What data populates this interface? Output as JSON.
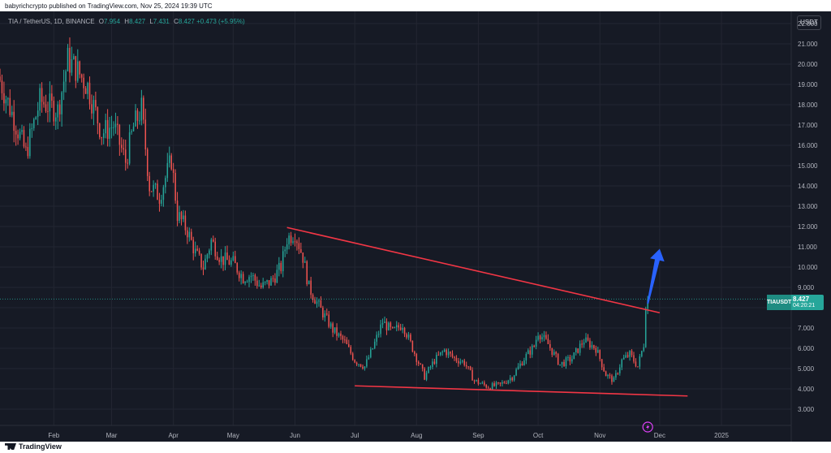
{
  "publisher_line": "babyrichcrypto published on TradingView.com, Nov 25, 2024 19:39 UTC",
  "legend": {
    "symbol": "TIA / TetherUS, 1D, BINANCE",
    "open_k": "O",
    "open": "7.954",
    "high_k": "H",
    "high": "8.427",
    "low_k": "L",
    "low": "7.431",
    "close_k": "C",
    "close": "8.427",
    "change": "+0.473 (+5.95%)"
  },
  "currency_button": "USDT",
  "price_tag": {
    "symbol": "TIAUSDT",
    "price": "8.427",
    "countdown": "04:20:21"
  },
  "footer": {
    "brand": "TradingView"
  },
  "colors": {
    "up": "#26a69a",
    "down": "#ef5350",
    "background": "#161a25",
    "trendline": "#f23645",
    "arrow": "#2962ff"
  },
  "chart_data": {
    "type": "candlestick",
    "title": "",
    "ylim": [
      2.2,
      22.6
    ],
    "y_ticks": [
      "3.000",
      "4.000",
      "5.000",
      "6.000",
      "7.000",
      "8.000",
      "9.000",
      "10.000",
      "11.000",
      "12.000",
      "13.000",
      "14.000",
      "15.000",
      "16.000",
      "17.000",
      "18.000",
      "19.000",
      "20.000",
      "21.000",
      "22.000"
    ],
    "x_ticks": [
      "Feb",
      "Mar",
      "Apr",
      "May",
      "Jun",
      "Jul",
      "Aug",
      "Sep",
      "Oct",
      "Nov",
      "Dec",
      "2025"
    ],
    "x_tick_dates": [
      "2024-02-01",
      "2024-03-01",
      "2024-04-01",
      "2024-05-01",
      "2024-06-01",
      "2024-07-01",
      "2024-08-01",
      "2024-09-01",
      "2024-10-01",
      "2024-11-01",
      "2024-12-01",
      "2025-01-01"
    ],
    "x_range": [
      "2024-01-05",
      "2025-02-05"
    ],
    "last_price": 8.427,
    "close_path": [
      [
        "2024-01-05",
        19.2
      ],
      [
        "2024-01-12",
        17.3
      ],
      [
        "2024-01-18",
        15.6
      ],
      [
        "2024-01-25",
        18.2
      ],
      [
        "2024-02-03",
        17.7
      ],
      [
        "2024-02-08",
        20.2
      ],
      [
        "2024-02-12",
        19.8
      ],
      [
        "2024-02-18",
        18.9
      ],
      [
        "2024-02-25",
        16.6
      ],
      [
        "2024-03-02",
        17.0
      ],
      [
        "2024-03-08",
        15.2
      ],
      [
        "2024-03-12",
        16.9
      ],
      [
        "2024-03-16",
        17.8
      ],
      [
        "2024-03-20",
        14.0
      ],
      [
        "2024-03-25",
        13.5
      ],
      [
        "2024-03-31",
        15.3
      ],
      [
        "2024-04-03",
        12.6
      ],
      [
        "2024-04-08",
        11.8
      ],
      [
        "2024-04-12",
        10.7
      ],
      [
        "2024-04-16",
        10.0
      ],
      [
        "2024-04-20",
        11.3
      ],
      [
        "2024-04-25",
        10.4
      ],
      [
        "2024-05-01",
        10.2
      ],
      [
        "2024-05-06",
        9.5
      ],
      [
        "2024-05-10",
        9.6
      ],
      [
        "2024-05-15",
        9.0
      ],
      [
        "2024-05-20",
        9.3
      ],
      [
        "2024-05-25",
        10.0
      ],
      [
        "2024-05-28",
        11.4
      ],
      [
        "2024-06-01",
        11.7
      ],
      [
        "2024-06-05",
        10.5
      ],
      [
        "2024-06-08",
        9.0
      ],
      [
        "2024-06-14",
        7.9
      ],
      [
        "2024-06-20",
        6.9
      ],
      [
        "2024-06-26",
        6.3
      ],
      [
        "2024-07-01",
        5.4
      ],
      [
        "2024-07-06",
        5.1
      ],
      [
        "2024-07-10",
        6.0
      ],
      [
        "2024-07-15",
        7.3
      ],
      [
        "2024-07-20",
        6.8
      ],
      [
        "2024-07-25",
        7.2
      ],
      [
        "2024-07-30",
        6.0
      ],
      [
        "2024-08-05",
        4.6
      ],
      [
        "2024-08-10",
        5.4
      ],
      [
        "2024-08-15",
        5.9
      ],
      [
        "2024-08-20",
        5.5
      ],
      [
        "2024-08-25",
        5.3
      ],
      [
        "2024-08-30",
        4.4
      ],
      [
        "2024-09-06",
        4.1
      ],
      [
        "2024-09-12",
        4.2
      ],
      [
        "2024-09-18",
        4.6
      ],
      [
        "2024-09-24",
        5.5
      ],
      [
        "2024-09-29",
        6.1
      ],
      [
        "2024-10-01",
        6.8
      ],
      [
        "2024-10-06",
        6.2
      ],
      [
        "2024-10-12",
        5.2
      ],
      [
        "2024-10-18",
        5.5
      ],
      [
        "2024-10-24",
        6.4
      ],
      [
        "2024-10-30",
        6.0
      ],
      [
        "2024-11-04",
        4.7
      ],
      [
        "2024-11-08",
        4.4
      ],
      [
        "2024-11-12",
        5.4
      ],
      [
        "2024-11-16",
        5.7
      ],
      [
        "2024-11-20",
        5.1
      ],
      [
        "2024-11-23",
        6.2
      ],
      [
        "2024-11-24",
        7.95
      ],
      [
        "2024-11-25",
        8.427
      ]
    ],
    "annotations": {
      "upper_trendline": [
        [
          "2024-05-28",
          11.95
        ],
        [
          "2024-12-01",
          7.75
        ]
      ],
      "lower_trendline": [
        [
          "2024-07-01",
          4.15
        ],
        [
          "2024-12-15",
          3.65
        ]
      ],
      "arrow": {
        "from": [
          "2024-11-25",
          8.2
        ],
        "to": [
          "2024-12-01",
          10.9
        ]
      },
      "last_price_line": 8.427
    }
  }
}
